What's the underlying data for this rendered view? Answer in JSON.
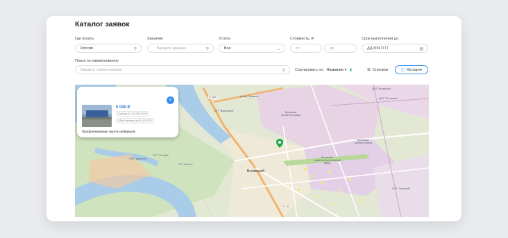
{
  "page": {
    "title": "Каталог заявок"
  },
  "filters": {
    "where_label": "Где искать",
    "where_value": "Россия",
    "customer_label": "Заказчик",
    "customer_placeholder": "Введите данные",
    "service_label": "Услуга",
    "service_value": "Все",
    "cost_label": "Стоимость, ₽",
    "cost_from_placeholder": "от",
    "cost_to_placeholder": "до",
    "deadline_label": "Срок выполнения до",
    "deadline_placeholder": "ДД.ММ.ГГГГ",
    "name_search_label": "Поиск по наименованию",
    "name_search_placeholder": "Введите наименование",
    "sort_label": "Сортировать по:",
    "sort_value": "Название"
  },
  "view_toggle": {
    "list_label": "Списком",
    "map_label": "На карте",
    "active": "map"
  },
  "popup": {
    "price": "5 000 ₽",
    "deadline": "Срок до 31.12.2025 00:00",
    "collection": "Сбор откликов до 30.12.2025",
    "title": "Профилирование грунта грейдером"
  },
  "map": {
    "labels": [
      "Волжский",
      "СНТ \"Вавилон\"",
      "СНТ \"Мечта\"",
      "СНТ \"Ахтуба\"",
      "Волжский трубный завод",
      "Волжский оргсинтез завод",
      "Волжский машиностроительный завод",
      "СНТ \"Зеленый\"",
      "ДНТ \"Волжская\"",
      "ДНТ \"Волжские\"",
      "улица Пушкина",
      "Р-228",
      "Р-221",
      "СНТ \"Вишневый\""
    ]
  },
  "colors": {
    "accent": "#3a8ef0",
    "map_pin": "#1fa84a"
  }
}
